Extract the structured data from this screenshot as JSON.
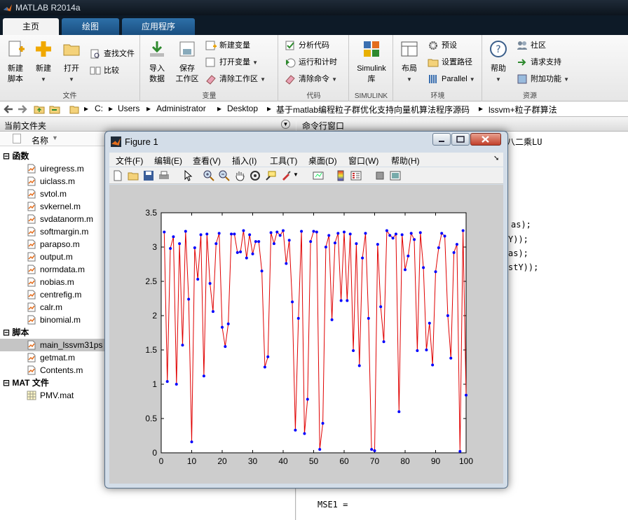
{
  "app": {
    "title": "MATLAB R2014a"
  },
  "tabs": [
    {
      "label": "主页",
      "active": true
    },
    {
      "label": "绘图",
      "active": false
    },
    {
      "label": "应用程序",
      "active": false
    }
  ],
  "ribbon": {
    "file": {
      "name": "文件",
      "new_script": "新建\n脚本",
      "new": "新建",
      "open": "打开",
      "find_files": "查找文件",
      "compare": "比较"
    },
    "variable": {
      "name": "变量",
      "import": "导入\n数据",
      "save_ws": "保存\n工作区",
      "new_var": "新建变量",
      "open_var": "打开变量",
      "clear_ws": "清除工作区"
    },
    "code": {
      "name": "代码",
      "analyze": "分析代码",
      "run_time": "运行和计时",
      "clear_cmd": "清除命令"
    },
    "simulink": {
      "name": "SIMULINK",
      "lib": "Simulink\n库"
    },
    "env": {
      "name": "环境",
      "layout": "布局",
      "prefs": "预设",
      "set_path": "设置路径",
      "parallel": "Parallel"
    },
    "resources": {
      "name": "资源",
      "help": "帮助",
      "community": "社区",
      "support": "请求支持",
      "addons": "附加功能"
    }
  },
  "path": {
    "crumbs": [
      "C:",
      "Users",
      "Administrator",
      "Desktop",
      "基于matlab编程粒子群优化支持向量机算法程序源码",
      "lssvm+粒子群算法"
    ]
  },
  "left": {
    "title": "当前文件夹",
    "col_name": "名称",
    "sections": [
      {
        "label": "函数",
        "files": [
          "uiregress.m",
          "uiclass.m",
          "svtol.m",
          "svkernel.m",
          "svdatanorm.m",
          "softmargin.m",
          "parapso.m",
          "output.m",
          "normdata.m",
          "nobias.m",
          "centrefig.m",
          "calr.m",
          "binomial.m"
        ]
      },
      {
        "label": "脚本",
        "files": [
          "main_lssvm31ps",
          "getmat.m",
          "Contents.m"
        ]
      },
      {
        "label": "MAT 文件",
        "files": [
          "PMV.mat"
        ]
      }
    ]
  },
  "right": {
    "title": "命令行窗口",
    "lines": [
      "八二乘LU",
      "as);",
      "Y));",
      "as);",
      "stY));"
    ],
    "mse": "MSE1 ="
  },
  "figure": {
    "title": "Figure 1",
    "menu": [
      "文件(F)",
      "编辑(E)",
      "查看(V)",
      "插入(I)",
      "工具(T)",
      "桌面(D)",
      "窗口(W)",
      "帮助(H)"
    ]
  },
  "colors": {
    "line": "#e00000",
    "marker": "#0000ff",
    "accent": "#2d6fa8"
  },
  "chart_data": {
    "type": "line",
    "xlim": [
      0,
      100
    ],
    "ylim": [
      0,
      3.5
    ],
    "xticks": [
      0,
      10,
      20,
      30,
      40,
      50,
      60,
      70,
      80,
      90,
      100
    ],
    "yticks": [
      0,
      0.5,
      1,
      1.5,
      2,
      2.5,
      3,
      3.5
    ],
    "x": [
      1,
      2,
      3,
      4,
      5,
      6,
      7,
      8,
      9,
      10,
      11,
      12,
      13,
      14,
      15,
      16,
      17,
      18,
      19,
      20,
      21,
      22,
      23,
      24,
      25,
      26,
      27,
      28,
      29,
      30,
      31,
      32,
      33,
      34,
      35,
      36,
      37,
      38,
      39,
      40,
      41,
      42,
      43,
      44,
      45,
      46,
      47,
      48,
      49,
      50,
      51,
      52,
      53,
      54,
      55,
      56,
      57,
      58,
      59,
      60,
      61,
      62,
      63,
      64,
      65,
      66,
      67,
      68,
      69,
      70,
      71,
      72,
      73,
      74,
      75,
      76,
      77,
      78,
      79,
      80,
      81,
      82,
      83,
      84,
      85,
      86,
      87,
      88,
      89,
      90,
      91,
      92,
      93,
      94,
      95,
      96,
      97,
      98,
      99,
      100
    ],
    "y": [
      3.22,
      1.04,
      2.98,
      3.15,
      1.0,
      3.05,
      1.57,
      3.23,
      2.24,
      0.16,
      2.99,
      2.53,
      3.18,
      1.12,
      3.19,
      2.47,
      2.06,
      3.05,
      3.2,
      1.83,
      1.55,
      1.88,
      3.19,
      3.19,
      2.92,
      2.93,
      3.24,
      2.84,
      3.18,
      2.9,
      3.08,
      3.08,
      2.65,
      1.25,
      1.4,
      3.21,
      3.05,
      3.22,
      3.17,
      3.24,
      2.76,
      3.1,
      2.2,
      0.33,
      1.96,
      3.23,
      0.28,
      0.78,
      3.08,
      3.23,
      3.22,
      0.05,
      0.43,
      3.0,
      3.17,
      1.94,
      3.06,
      3.2,
      2.22,
      3.22,
      2.22,
      3.19,
      1.49,
      3.05,
      1.27,
      2.84,
      3.2,
      1.96,
      0.05,
      0.03,
      3.04,
      2.13,
      1.62,
      3.24,
      3.17,
      3.13,
      3.19,
      0.6,
      3.18,
      2.67,
      2.87,
      3.2,
      3.11,
      1.49,
      3.21,
      2.7,
      1.5,
      1.89,
      1.28,
      2.64,
      2.99,
      3.2,
      3.16,
      2.0,
      1.38,
      2.92,
      3.04,
      0.02,
      3.24,
      0.84
    ]
  }
}
